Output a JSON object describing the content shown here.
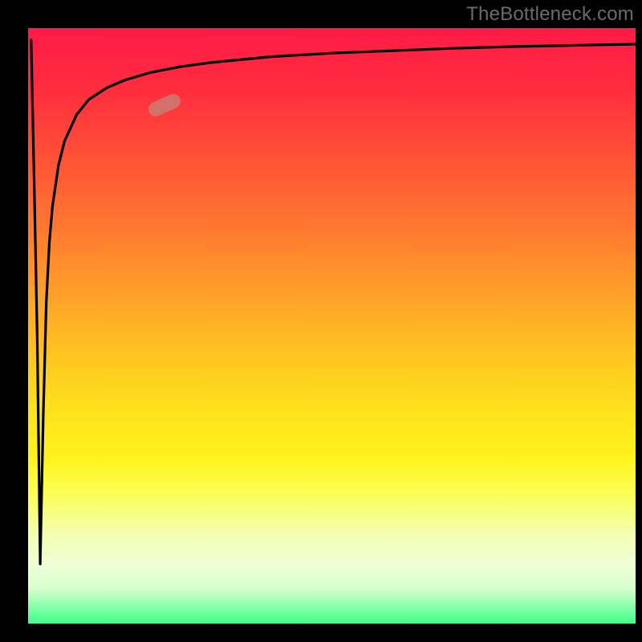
{
  "watermark": "TheBottleneck.com",
  "marker": {
    "x_frac": 0.225,
    "y_frac": 0.13,
    "rotation_deg": -24
  },
  "colors": {
    "curve": "#000000",
    "marker": "rgba(198,130,118,0.78)",
    "gradient_top": "#ff1a46",
    "gradient_bottom": "#3fff88"
  },
  "chart_data": {
    "type": "line",
    "title": "",
    "xlabel": "",
    "ylabel": "",
    "xlim": [
      0,
      100
    ],
    "ylim": [
      0,
      100
    ],
    "grid": false,
    "legend": false,
    "series": [
      {
        "name": "bottleneck-curve",
        "x": [
          0.5,
          1,
          1.5,
          2,
          2.5,
          3,
          3.5,
          4,
          5,
          6,
          8,
          10,
          13,
          16,
          20,
          25,
          30,
          40,
          50,
          60,
          70,
          80,
          90,
          100
        ],
        "y": [
          98,
          74,
          48,
          10,
          35,
          54,
          64,
          70,
          77,
          81,
          85.5,
          88,
          90,
          91.3,
          92.5,
          93.5,
          94.2,
          95.2,
          95.8,
          96.2,
          96.6,
          96.9,
          97.1,
          97.3
        ]
      }
    ],
    "annotations": [
      {
        "name": "highlight-pill",
        "x": 22,
        "y": 92,
        "shape": "rounded-rect",
        "color": "rgba(198,130,118,0.78)"
      }
    ]
  }
}
